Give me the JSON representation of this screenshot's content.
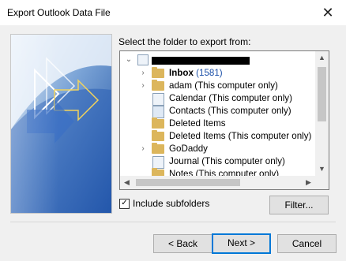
{
  "window": {
    "title": "Export Outlook Data File",
    "close_icon": "close-icon"
  },
  "prompt": "Select the folder to export from:",
  "tree": {
    "items": [
      {
        "label": "Inbox",
        "count": "(1581)",
        "icon": "folder-icon",
        "expander": "chevron-right"
      },
      {
        "label": "adam (This computer only)",
        "icon": "folder-icon",
        "expander": "chevron-right"
      },
      {
        "label": "Calendar (This computer only)",
        "icon": "calendar-icon"
      },
      {
        "label": "Contacts (This computer only)",
        "icon": "contacts-icon"
      },
      {
        "label": "Deleted Items",
        "icon": "folder-icon"
      },
      {
        "label": "Deleted Items (This computer only)",
        "icon": "folder-icon"
      },
      {
        "label": "GoDaddy",
        "icon": "folder-icon",
        "expander": "chevron-right"
      },
      {
        "label": "Journal (This computer only)",
        "icon": "journal-icon"
      },
      {
        "label": "Notes (This computer only)",
        "icon": "notes-icon"
      }
    ]
  },
  "include_subfolders": {
    "label": "Include subfolders",
    "checked": true
  },
  "buttons": {
    "filter": "Filter...",
    "back": "< Back",
    "next": "Next >",
    "cancel": "Cancel"
  },
  "colors": {
    "accent": "#0078d7",
    "folder": "#dcb65c",
    "count": "#1a4fa8"
  }
}
